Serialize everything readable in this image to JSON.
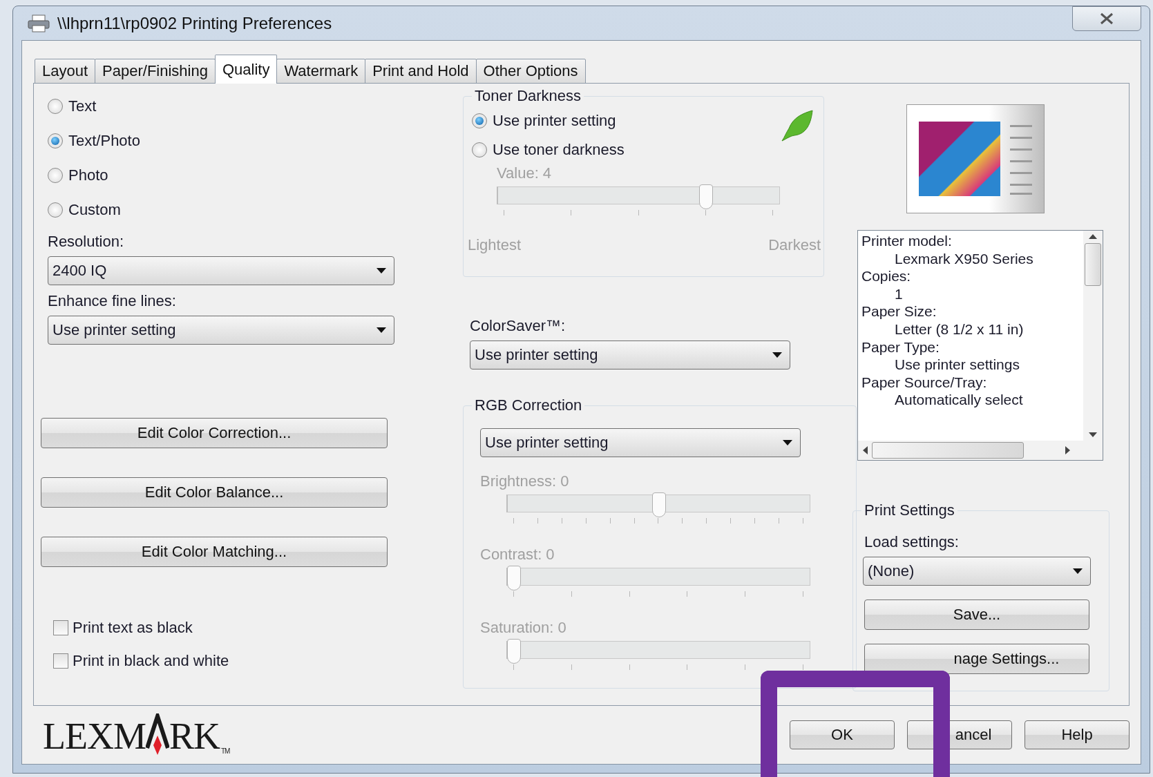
{
  "window": {
    "title": "\\\\lhprn11\\rp0902 Printing Preferences"
  },
  "tabs": [
    {
      "label": "Layout",
      "selected": false
    },
    {
      "label": "Paper/Finishing",
      "selected": false
    },
    {
      "label": "Quality",
      "selected": true
    },
    {
      "label": "Watermark",
      "selected": false
    },
    {
      "label": "Print and Hold",
      "selected": false
    },
    {
      "label": "Other Options",
      "selected": false
    }
  ],
  "quality_modes": [
    {
      "label": "Text",
      "selected": false
    },
    {
      "label": "Text/Photo",
      "selected": true
    },
    {
      "label": "Photo",
      "selected": false
    },
    {
      "label": "Custom",
      "selected": false
    }
  ],
  "resolution": {
    "label": "Resolution:",
    "value": "2400 IQ"
  },
  "enhance_fine_lines": {
    "label": "Enhance fine lines:",
    "value": "Use printer setting"
  },
  "color_buttons": [
    "Edit Color Correction...",
    "Edit Color Balance...",
    "Edit Color Matching..."
  ],
  "checkboxes": [
    {
      "label": "Print text as black",
      "checked": false
    },
    {
      "label": "Print in black and white",
      "checked": false
    }
  ],
  "toner_darkness": {
    "title": "Toner Darkness",
    "options": [
      {
        "label": "Use printer setting",
        "selected": true
      },
      {
        "label": "Use toner darkness",
        "selected": false
      }
    ],
    "value_label": "Value: 4",
    "level": 0.75,
    "disabled": true,
    "min_label": "Lightest",
    "max_label": "Darkest"
  },
  "colorsaver": {
    "label": "ColorSaver™:",
    "value": "Use printer setting"
  },
  "rgb_correction": {
    "title": "RGB Correction",
    "value": "Use printer setting",
    "sliders": [
      {
        "label": "Brightness: 0",
        "level": 0.5,
        "disabled": true
      },
      {
        "label": "Contrast: 0",
        "level": 0,
        "disabled": true
      },
      {
        "label": "Saturation: 0",
        "level": 0,
        "disabled": true
      }
    ]
  },
  "summary": [
    {
      "kind": "heading",
      "text": "Printer model:"
    },
    {
      "kind": "value",
      "text": "Lexmark X950 Series"
    },
    {
      "kind": "heading",
      "text": "Copies:"
    },
    {
      "kind": "value",
      "text": "1"
    },
    {
      "kind": "heading",
      "text": "Paper Size:"
    },
    {
      "kind": "value",
      "text": "Letter (8 1/2 x 11 in)"
    },
    {
      "kind": "heading",
      "text": "Paper Type:"
    },
    {
      "kind": "value",
      "text": "Use printer settings"
    },
    {
      "kind": "heading",
      "text": "Paper Source/Tray:"
    },
    {
      "kind": "value",
      "text": "Automatically select"
    }
  ],
  "print_settings": {
    "title": "Print Settings",
    "load_label": "Load settings:",
    "load_value": "(None)",
    "buttons": [
      "Save...",
      "nage Settings..."
    ]
  },
  "dialog_buttons": [
    "OK",
    "ancel",
    "Help"
  ],
  "logo": {
    "wordmark_left": "LEXM",
    "wordmark_right": "RK",
    "trademark": "TM"
  }
}
